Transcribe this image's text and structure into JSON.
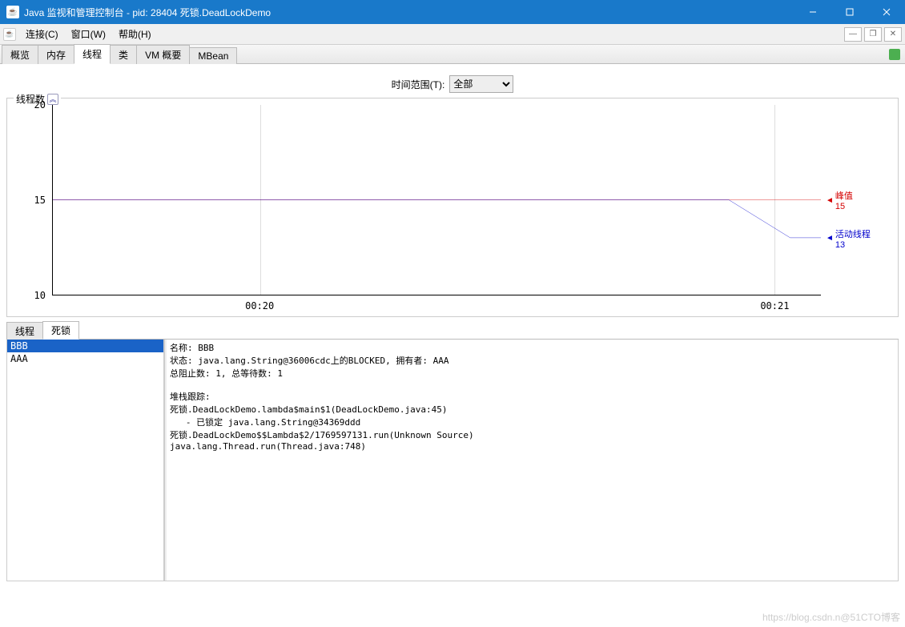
{
  "titlebar": {
    "title": "Java 监视和管理控制台 - pid: 28404 死锁.DeadLockDemo"
  },
  "menubar": {
    "items": [
      "连接(C)",
      "窗口(W)",
      "帮助(H)"
    ]
  },
  "tabs": {
    "items": [
      "概览",
      "内存",
      "线程",
      "类",
      "VM 概要",
      "MBean"
    ],
    "active": 2
  },
  "time_range": {
    "label": "时间范围(T):",
    "value": "全部"
  },
  "chart_group_label": "线程数",
  "chart_data": {
    "type": "line",
    "title": "线程数",
    "ylabel": "",
    "xlabel": "",
    "ylim": [
      10,
      20
    ],
    "yticks": [
      10,
      15,
      20
    ],
    "xticks": [
      "00:20",
      "00:21"
    ],
    "series": [
      {
        "name": "峰值",
        "color": "#d40000",
        "x_pct": [
          0,
          100
        ],
        "y": [
          15,
          15
        ],
        "end_value": 15
      },
      {
        "name": "活动线程",
        "color": "#0000cc",
        "x_pct": [
          0,
          88,
          96,
          100
        ],
        "y": [
          15,
          15,
          13,
          13
        ],
        "end_value": 13
      }
    ]
  },
  "subtabs": {
    "items": [
      "线程",
      "死锁"
    ],
    "active": 1
  },
  "thread_list": {
    "items": [
      "BBB",
      "AAA"
    ],
    "selected": 0
  },
  "detail": {
    "lines": [
      "名称: BBB",
      "状态: java.lang.String@36006cdc上的BLOCKED, 拥有者: AAA",
      "总阻止数: 1, 总等待数: 1",
      "",
      "堆栈跟踪: ",
      "死锁.DeadLockDemo.lambda$main$1(DeadLockDemo.java:45)",
      "   - 已锁定 java.lang.String@34369ddd",
      "死锁.DeadLockDemo$$Lambda$2/1769597131.run(Unknown Source)",
      "java.lang.Thread.run(Thread.java:748)"
    ]
  },
  "watermark": "https://blog.csdn.n@51CTO博客"
}
